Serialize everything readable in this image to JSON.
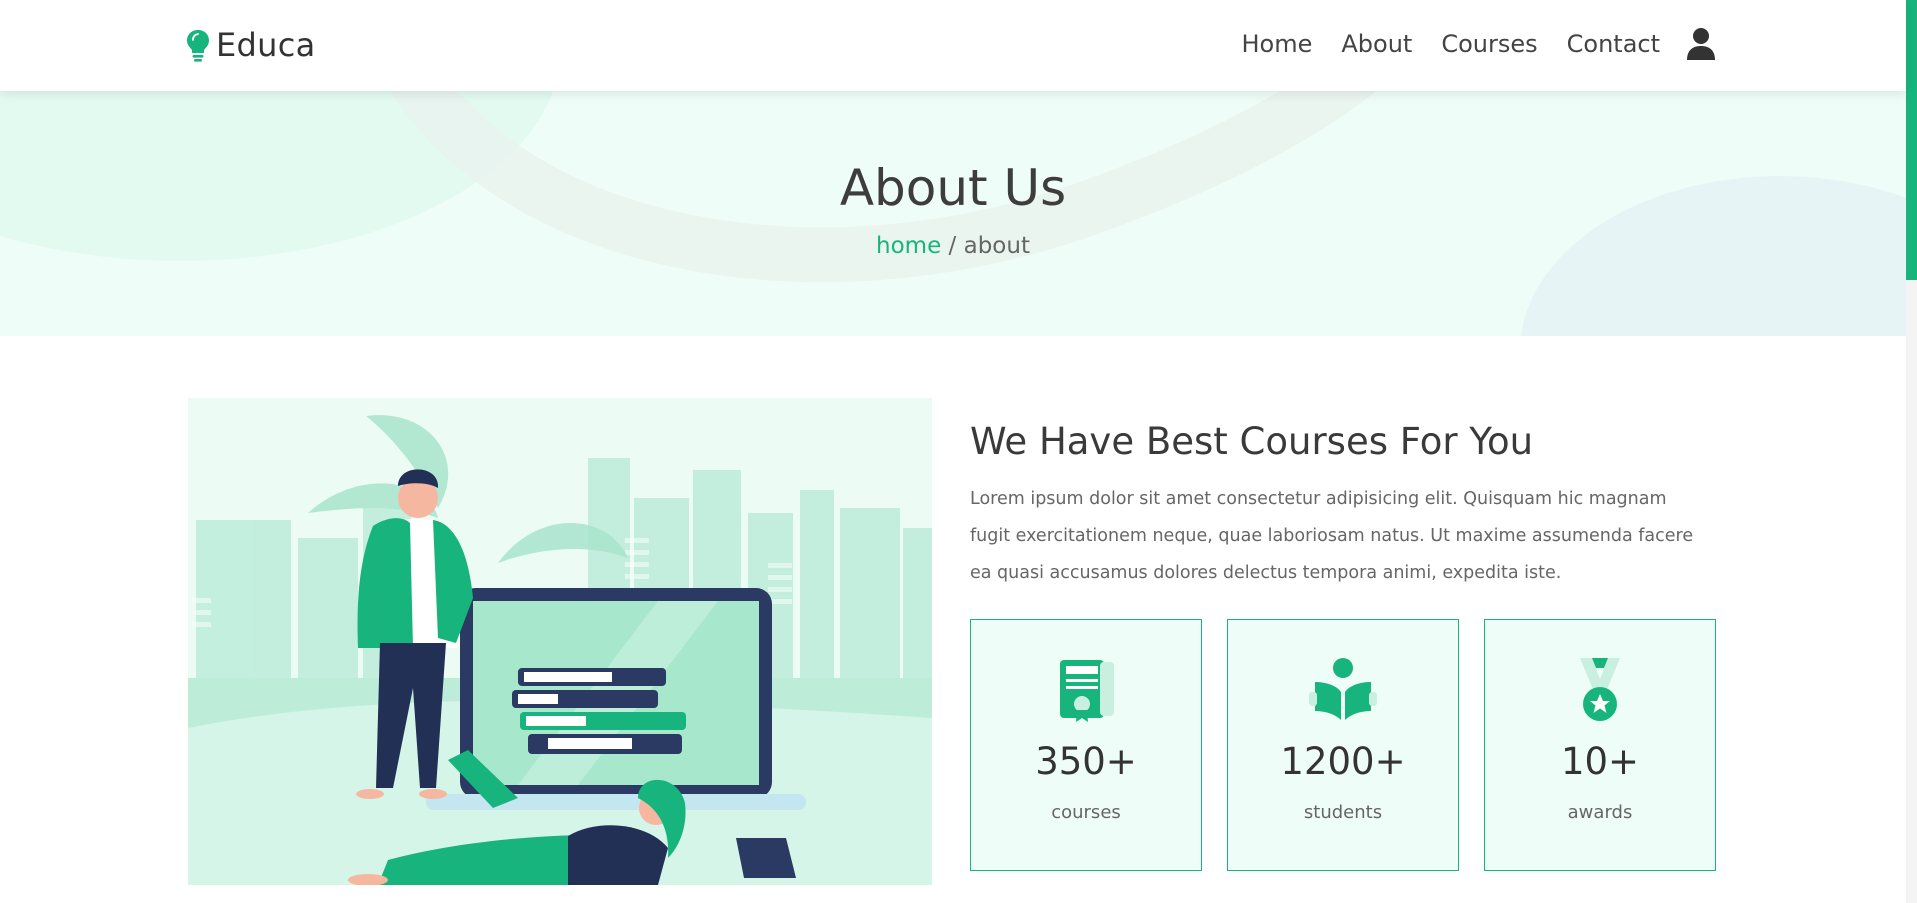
{
  "brand": {
    "name": "Educa",
    "icon": "lightbulb-icon",
    "accent": "#18b47e"
  },
  "nav": {
    "items": [
      "Home",
      "About",
      "Courses",
      "Contact"
    ],
    "user_icon": "user-icon"
  },
  "hero": {
    "title": "About Us",
    "breadcrumb": {
      "home": "home",
      "separator": " / ",
      "current": "about"
    }
  },
  "about": {
    "title": "We Have Best Courses For You",
    "text": "Lorem ipsum dolor sit amet consectetur adipisicing elit. Quisquam hic magnam fugit exercitationem neque, quae laboriosam natus. Ut maxime assumenda facere ea quasi accusamus dolores delectus tempora animi, expedita iste.",
    "stats": [
      {
        "icon": "certificate-icon",
        "value": "350+",
        "label": "courses"
      },
      {
        "icon": "reading-student-icon",
        "value": "1200+",
        "label": "students"
      },
      {
        "icon": "medal-icon",
        "value": "10+",
        "label": "awards"
      }
    ]
  }
}
